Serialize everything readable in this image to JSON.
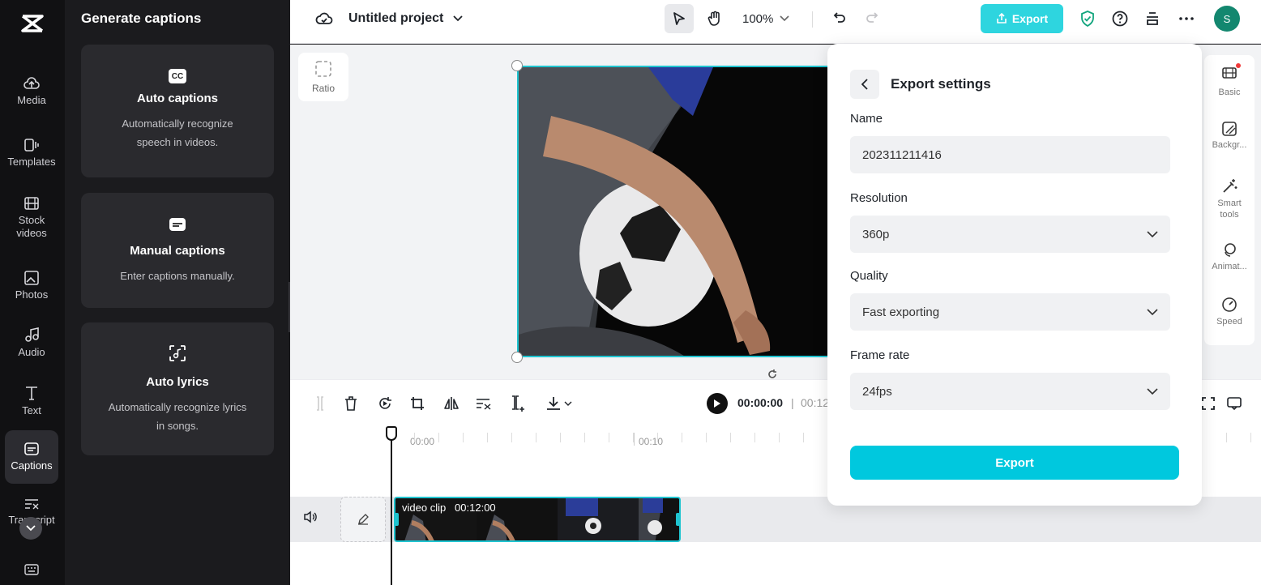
{
  "rail": {
    "items": [
      {
        "label": "Media"
      },
      {
        "label": "Templates"
      },
      {
        "label": "Stock videos"
      },
      {
        "label": "Photos"
      },
      {
        "label": "Audio"
      },
      {
        "label": "Text"
      },
      {
        "label": "Captions"
      },
      {
        "label": "Transcript"
      },
      {
        "label": ""
      }
    ]
  },
  "panel": {
    "title": "Generate captions",
    "cards": [
      {
        "title": "Auto captions",
        "desc": "Automatically recognize speech in videos.",
        "icon": "cc-icon"
      },
      {
        "title": "Manual captions",
        "desc": "Enter captions manually.",
        "icon": "caption-box-icon"
      },
      {
        "title": "Auto lyrics",
        "desc": "Automatically recognize lyrics in songs.",
        "icon": "lyrics-icon"
      }
    ]
  },
  "topbar": {
    "project_name": "Untitled project",
    "zoom": "100%",
    "export_label": "Export",
    "avatar_initial": "S"
  },
  "canvas": {
    "ratio_label": "Ratio"
  },
  "right_rail": {
    "items": [
      {
        "label": "Basic"
      },
      {
        "label": "Backgr..."
      },
      {
        "label": "Smart tools"
      },
      {
        "label": "Animat..."
      },
      {
        "label": "Speed"
      }
    ]
  },
  "timeline": {
    "current_time": "00:00:00",
    "separator": "|",
    "total_time": "00:12",
    "ruler": [
      "00:00",
      "00:10"
    ],
    "clip_label": "video clip",
    "clip_duration": "00:12:00"
  },
  "export_modal": {
    "title": "Export settings",
    "name_label": "Name",
    "name_value": "202311211416",
    "resolution_label": "Resolution",
    "resolution_value": "360p",
    "quality_label": "Quality",
    "quality_value": "Fast exporting",
    "framerate_label": "Frame rate",
    "framerate_value": "24fps",
    "export_button": "Export"
  },
  "colors": {
    "accent": "#2ed5df",
    "selection": "#1fc4d0",
    "avatar": "#13876f"
  }
}
